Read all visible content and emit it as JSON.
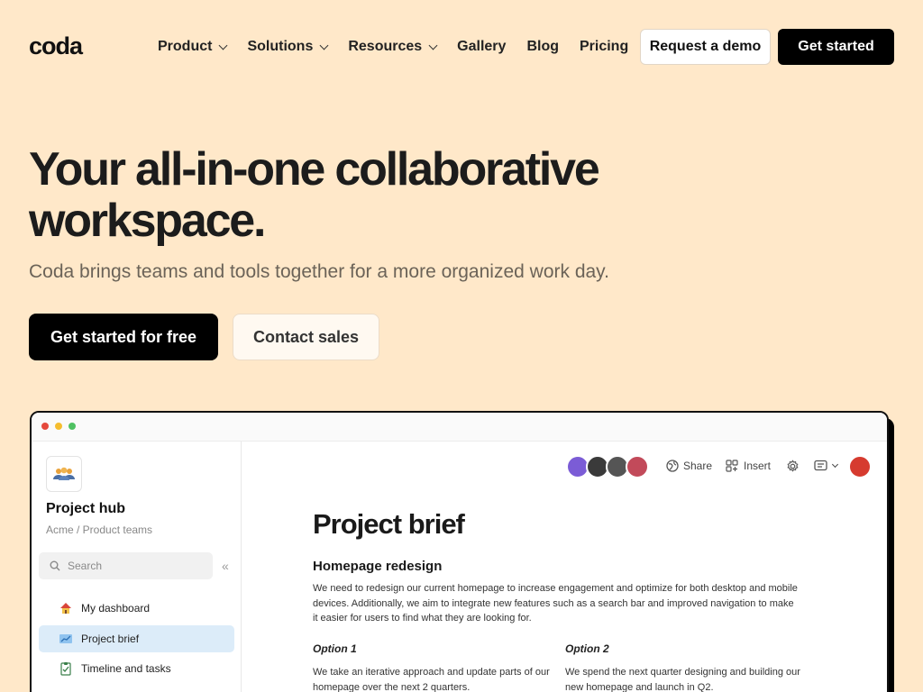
{
  "nav": {
    "logo": "coda",
    "items": [
      {
        "label": "Product",
        "dropdown": true
      },
      {
        "label": "Solutions",
        "dropdown": true
      },
      {
        "label": "Resources",
        "dropdown": true
      },
      {
        "label": "Gallery",
        "dropdown": false
      },
      {
        "label": "Blog",
        "dropdown": false
      },
      {
        "label": "Pricing",
        "dropdown": false
      }
    ],
    "demo_label": "Request a demo",
    "start_label": "Get started"
  },
  "hero": {
    "title_line1": "Your all-in-one collaborative",
    "title_line2": "workspace.",
    "subtitle": "Coda brings teams and tools together for a more organized work day.",
    "primary_cta": "Get started for free",
    "secondary_cta": "Contact sales"
  },
  "app": {
    "window_dots": [
      "#e5493d",
      "#f5bd2f",
      "#4fc162"
    ],
    "sidebar": {
      "hub_title": "Project hub",
      "hub_sub": "Acme / Product teams",
      "search_placeholder": "Search",
      "collapse_glyph": "«",
      "items": [
        {
          "label": "My dashboard",
          "icon": "house-icon",
          "active": false
        },
        {
          "label": "Project brief",
          "icon": "chart-icon",
          "active": true
        },
        {
          "label": "Timeline and tasks",
          "icon": "checklist-icon",
          "active": false
        }
      ]
    },
    "toolbar": {
      "share_label": "Share",
      "insert_label": "Insert",
      "avatar_colors": [
        "#7b5cd6",
        "#3a3a3a",
        "#555555",
        "#c24a5a"
      ]
    },
    "doc": {
      "title": "Project brief",
      "heading": "Homepage redesign",
      "paragraph": "We need to redesign our current homepage to increase engagement and optimize for both desktop and mobile devices. Additionally, we aim to integrate new features such as a search bar and improved navigation to make it easier for users to find what they are looking for.",
      "option1_title": "Option 1",
      "option1_text": "We take an iterative approach and update parts of our homepage over the next 2 quarters.",
      "option2_title": "Option 2",
      "option2_text": "We spend the next quarter designing and building our new homepage and launch in Q2."
    }
  }
}
